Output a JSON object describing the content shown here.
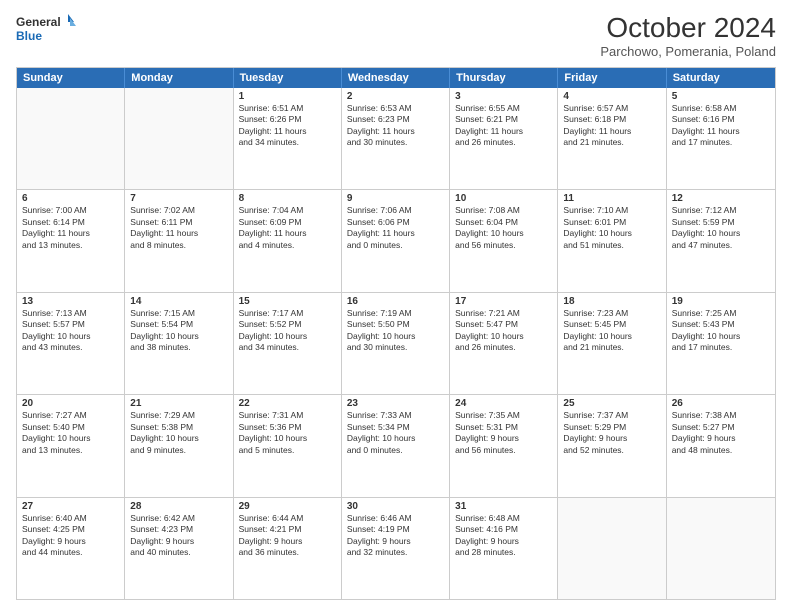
{
  "logo": {
    "line1": "General",
    "line2": "Blue"
  },
  "title": "October 2024",
  "subtitle": "Parchowo, Pomerania, Poland",
  "header_days": [
    "Sunday",
    "Monday",
    "Tuesday",
    "Wednesday",
    "Thursday",
    "Friday",
    "Saturday"
  ],
  "rows": [
    [
      {
        "day": "",
        "text": ""
      },
      {
        "day": "",
        "text": ""
      },
      {
        "day": "1",
        "text": "Sunrise: 6:51 AM\nSunset: 6:26 PM\nDaylight: 11 hours\nand 34 minutes."
      },
      {
        "day": "2",
        "text": "Sunrise: 6:53 AM\nSunset: 6:23 PM\nDaylight: 11 hours\nand 30 minutes."
      },
      {
        "day": "3",
        "text": "Sunrise: 6:55 AM\nSunset: 6:21 PM\nDaylight: 11 hours\nand 26 minutes."
      },
      {
        "day": "4",
        "text": "Sunrise: 6:57 AM\nSunset: 6:18 PM\nDaylight: 11 hours\nand 21 minutes."
      },
      {
        "day": "5",
        "text": "Sunrise: 6:58 AM\nSunset: 6:16 PM\nDaylight: 11 hours\nand 17 minutes."
      }
    ],
    [
      {
        "day": "6",
        "text": "Sunrise: 7:00 AM\nSunset: 6:14 PM\nDaylight: 11 hours\nand 13 minutes."
      },
      {
        "day": "7",
        "text": "Sunrise: 7:02 AM\nSunset: 6:11 PM\nDaylight: 11 hours\nand 8 minutes."
      },
      {
        "day": "8",
        "text": "Sunrise: 7:04 AM\nSunset: 6:09 PM\nDaylight: 11 hours\nand 4 minutes."
      },
      {
        "day": "9",
        "text": "Sunrise: 7:06 AM\nSunset: 6:06 PM\nDaylight: 11 hours\nand 0 minutes."
      },
      {
        "day": "10",
        "text": "Sunrise: 7:08 AM\nSunset: 6:04 PM\nDaylight: 10 hours\nand 56 minutes."
      },
      {
        "day": "11",
        "text": "Sunrise: 7:10 AM\nSunset: 6:01 PM\nDaylight: 10 hours\nand 51 minutes."
      },
      {
        "day": "12",
        "text": "Sunrise: 7:12 AM\nSunset: 5:59 PM\nDaylight: 10 hours\nand 47 minutes."
      }
    ],
    [
      {
        "day": "13",
        "text": "Sunrise: 7:13 AM\nSunset: 5:57 PM\nDaylight: 10 hours\nand 43 minutes."
      },
      {
        "day": "14",
        "text": "Sunrise: 7:15 AM\nSunset: 5:54 PM\nDaylight: 10 hours\nand 38 minutes."
      },
      {
        "day": "15",
        "text": "Sunrise: 7:17 AM\nSunset: 5:52 PM\nDaylight: 10 hours\nand 34 minutes."
      },
      {
        "day": "16",
        "text": "Sunrise: 7:19 AM\nSunset: 5:50 PM\nDaylight: 10 hours\nand 30 minutes."
      },
      {
        "day": "17",
        "text": "Sunrise: 7:21 AM\nSunset: 5:47 PM\nDaylight: 10 hours\nand 26 minutes."
      },
      {
        "day": "18",
        "text": "Sunrise: 7:23 AM\nSunset: 5:45 PM\nDaylight: 10 hours\nand 21 minutes."
      },
      {
        "day": "19",
        "text": "Sunrise: 7:25 AM\nSunset: 5:43 PM\nDaylight: 10 hours\nand 17 minutes."
      }
    ],
    [
      {
        "day": "20",
        "text": "Sunrise: 7:27 AM\nSunset: 5:40 PM\nDaylight: 10 hours\nand 13 minutes."
      },
      {
        "day": "21",
        "text": "Sunrise: 7:29 AM\nSunset: 5:38 PM\nDaylight: 10 hours\nand 9 minutes."
      },
      {
        "day": "22",
        "text": "Sunrise: 7:31 AM\nSunset: 5:36 PM\nDaylight: 10 hours\nand 5 minutes."
      },
      {
        "day": "23",
        "text": "Sunrise: 7:33 AM\nSunset: 5:34 PM\nDaylight: 10 hours\nand 0 minutes."
      },
      {
        "day": "24",
        "text": "Sunrise: 7:35 AM\nSunset: 5:31 PM\nDaylight: 9 hours\nand 56 minutes."
      },
      {
        "day": "25",
        "text": "Sunrise: 7:37 AM\nSunset: 5:29 PM\nDaylight: 9 hours\nand 52 minutes."
      },
      {
        "day": "26",
        "text": "Sunrise: 7:38 AM\nSunset: 5:27 PM\nDaylight: 9 hours\nand 48 minutes."
      }
    ],
    [
      {
        "day": "27",
        "text": "Sunrise: 6:40 AM\nSunset: 4:25 PM\nDaylight: 9 hours\nand 44 minutes."
      },
      {
        "day": "28",
        "text": "Sunrise: 6:42 AM\nSunset: 4:23 PM\nDaylight: 9 hours\nand 40 minutes."
      },
      {
        "day": "29",
        "text": "Sunrise: 6:44 AM\nSunset: 4:21 PM\nDaylight: 9 hours\nand 36 minutes."
      },
      {
        "day": "30",
        "text": "Sunrise: 6:46 AM\nSunset: 4:19 PM\nDaylight: 9 hours\nand 32 minutes."
      },
      {
        "day": "31",
        "text": "Sunrise: 6:48 AM\nSunset: 4:16 PM\nDaylight: 9 hours\nand 28 minutes."
      },
      {
        "day": "",
        "text": ""
      },
      {
        "day": "",
        "text": ""
      }
    ]
  ]
}
